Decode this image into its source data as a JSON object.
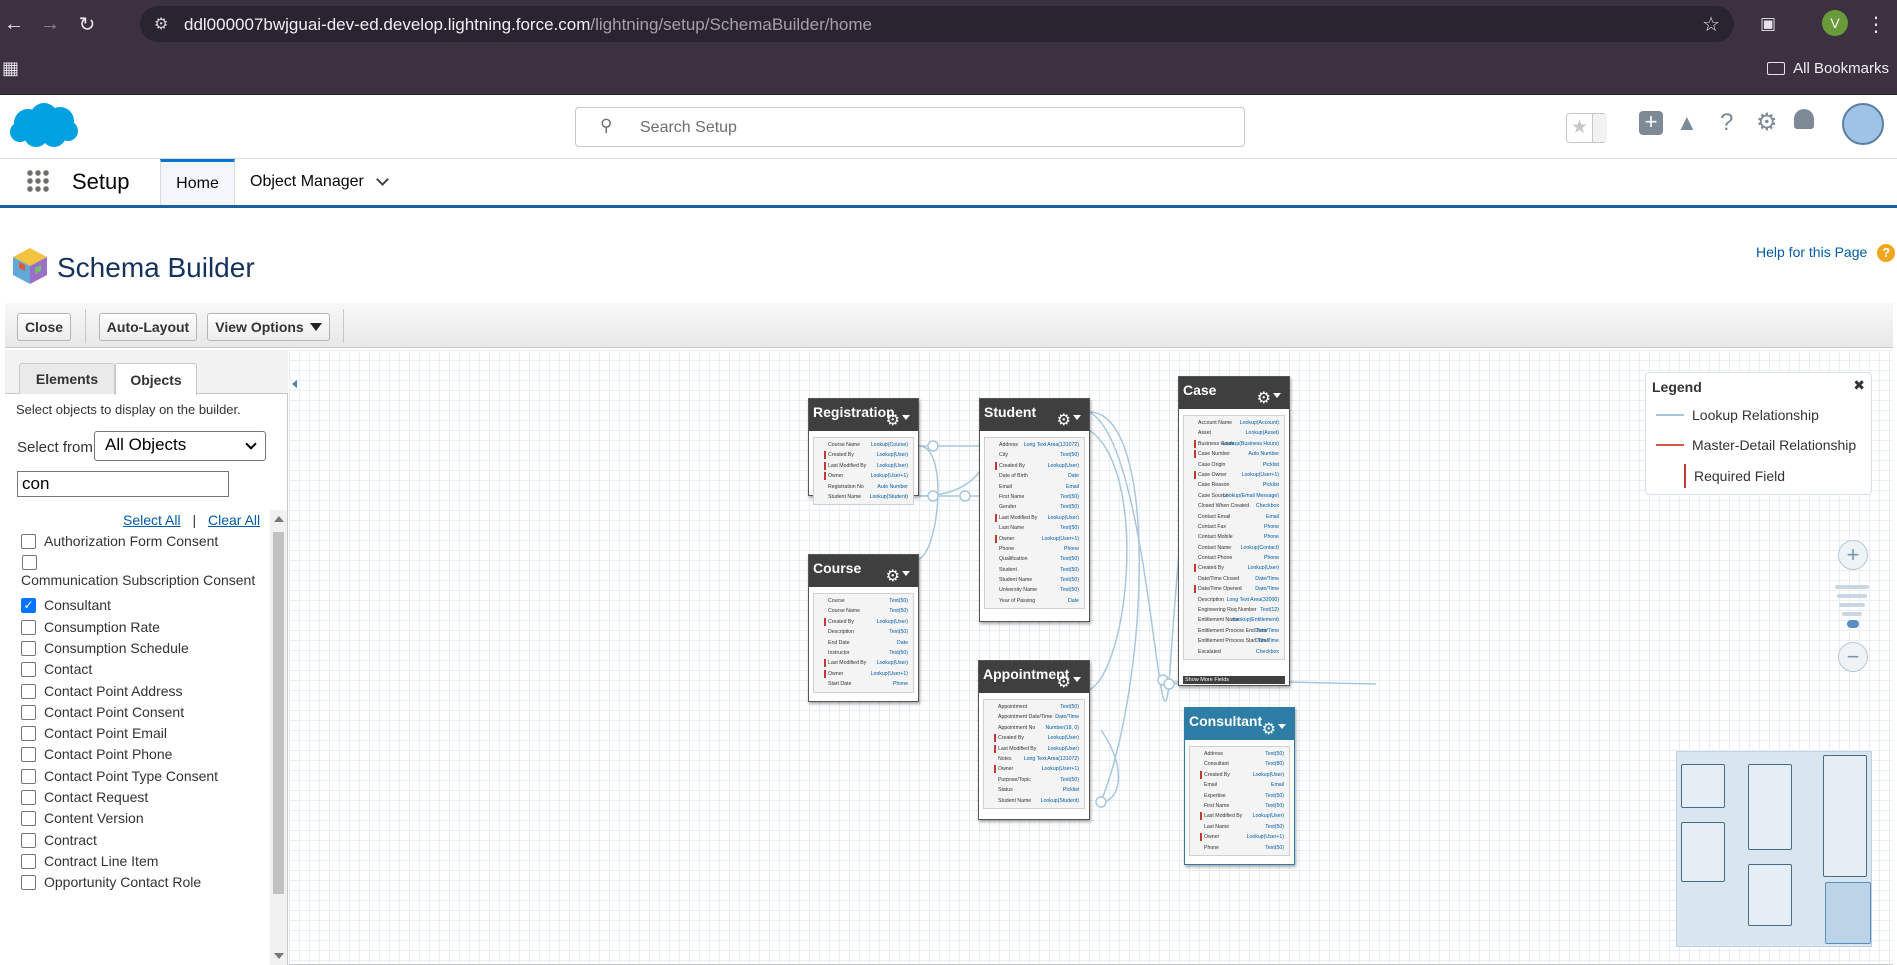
{
  "browser": {
    "url_host": "ddl000007bwjguai-dev-ed.develop.lightning.force.com",
    "url_path": "/lightning/setup/SchemaBuilder/home",
    "profile_initial": "V",
    "all_bookmarks": "All Bookmarks"
  },
  "header": {
    "search_placeholder": "Search Setup"
  },
  "nav": {
    "app_name": "Setup",
    "tabs": [
      "Home",
      "Object Manager"
    ]
  },
  "page": {
    "title": "Schema Builder",
    "help_link": "Help for this Page"
  },
  "toolbar": {
    "close": "Close",
    "auto_layout": "Auto-Layout",
    "view_options": "View Options"
  },
  "left_panel": {
    "tabs": [
      "Elements",
      "Objects"
    ],
    "description": "Select objects to display on the builder.",
    "select_from_label": "Select from",
    "select_from_value": "All Objects",
    "filter_value": "con",
    "select_all": "Select All",
    "clear_all": "Clear All",
    "objects": [
      {
        "label": "Authorization Form Consent",
        "checked": false
      },
      {
        "label": "Communication Subscription Consent",
        "checked": false
      },
      {
        "label": "Consultant",
        "checked": true
      },
      {
        "label": "Consumption Rate",
        "checked": false
      },
      {
        "label": "Consumption Schedule",
        "checked": false
      },
      {
        "label": "Contact",
        "checked": false
      },
      {
        "label": "Contact Point Address",
        "checked": false
      },
      {
        "label": "Contact Point Consent",
        "checked": false
      },
      {
        "label": "Contact Point Email",
        "checked": false
      },
      {
        "label": "Contact Point Phone",
        "checked": false
      },
      {
        "label": "Contact Point Type Consent",
        "checked": false
      },
      {
        "label": "Contact Request",
        "checked": false
      },
      {
        "label": "Content Version",
        "checked": false
      },
      {
        "label": "Contract",
        "checked": false
      },
      {
        "label": "Contract Line Item",
        "checked": false
      },
      {
        "label": "Opportunity Contact Role",
        "checked": false
      }
    ]
  },
  "schema_objects": {
    "registration": {
      "name": "Registration",
      "fields": [
        {
          "name": "Course Name",
          "type": "Lookup(Course)",
          "req": false
        },
        {
          "name": "Created By",
          "type": "Lookup(User)",
          "req": true
        },
        {
          "name": "Last Modified By",
          "type": "Lookup(User)",
          "req": true
        },
        {
          "name": "Owner",
          "type": "Lookup(User+1)",
          "req": true
        },
        {
          "name": "Registration No",
          "type": "Auto Number",
          "req": false
        },
        {
          "name": "Student Name",
          "type": "Lookup(Student)",
          "req": false
        }
      ]
    },
    "course": {
      "name": "Course",
      "fields": [
        {
          "name": "Course",
          "type": "Text(50)",
          "req": false
        },
        {
          "name": "Course Name",
          "type": "Text(50)",
          "req": false
        },
        {
          "name": "Created By",
          "type": "Lookup(User)",
          "req": true
        },
        {
          "name": "Description",
          "type": "Text(50)",
          "req": false
        },
        {
          "name": "End Date",
          "type": "Date",
          "req": false
        },
        {
          "name": "Instructor",
          "type": "Text(50)",
          "req": false
        },
        {
          "name": "Last Modified By",
          "type": "Lookup(User)",
          "req": true
        },
        {
          "name": "Owner",
          "type": "Lookup(User+1)",
          "req": true
        },
        {
          "name": "Start Date",
          "type": "Phone",
          "req": false
        }
      ]
    },
    "student": {
      "name": "Student",
      "fields": [
        {
          "name": "Address",
          "type": "Long Text Area(131072)",
          "req": false
        },
        {
          "name": "City",
          "type": "Text(50)",
          "req": false
        },
        {
          "name": "Created By",
          "type": "Lookup(User)",
          "req": true
        },
        {
          "name": "Date of Birth",
          "type": "Date",
          "req": false
        },
        {
          "name": "Email",
          "type": "Email",
          "req": false
        },
        {
          "name": "First Name",
          "type": "Text(50)",
          "req": false
        },
        {
          "name": "Gender",
          "type": "Text(50)",
          "req": false
        },
        {
          "name": "Last Modified By",
          "type": "Lookup(User)",
          "req": true
        },
        {
          "name": "Last Name",
          "type": "Text(50)",
          "req": false
        },
        {
          "name": "Owner",
          "type": "Lookup(User+1)",
          "req": true
        },
        {
          "name": "Phone",
          "type": "Phone",
          "req": false
        },
        {
          "name": "Qualification",
          "type": "Text(50)",
          "req": false
        },
        {
          "name": "Student",
          "type": "Text(50)",
          "req": false
        },
        {
          "name": "Student Name",
          "type": "Text(50)",
          "req": false
        },
        {
          "name": "University Name",
          "type": "Text(50)",
          "req": false
        },
        {
          "name": "Year of Passing",
          "type": "Date",
          "req": false
        }
      ]
    },
    "appointment": {
      "name": "Appointment",
      "fields": [
        {
          "name": "Appointment",
          "type": "Text(50)",
          "req": false
        },
        {
          "name": "Appointment Date/Time",
          "type": "Date/Time",
          "req": false
        },
        {
          "name": "Appointment No",
          "type": "Number(18, 0)",
          "req": false
        },
        {
          "name": "Created By",
          "type": "Lookup(User)",
          "req": true
        },
        {
          "name": "Last Modified By",
          "type": "Lookup(User)",
          "req": true
        },
        {
          "name": "Notes",
          "type": "Long Text Area(131072)",
          "req": false
        },
        {
          "name": "Owner",
          "type": "Lookup(User+1)",
          "req": true
        },
        {
          "name": "Purpose/Topic",
          "type": "Text(50)",
          "req": false
        },
        {
          "name": "Status",
          "type": "Picklist",
          "req": false
        },
        {
          "name": "Student Name",
          "type": "Lookup(Student)",
          "req": false
        }
      ]
    },
    "case": {
      "name": "Case",
      "show_more": "Show More Fields",
      "fields": [
        {
          "name": "Account Name",
          "type": "Lookup(Account)",
          "req": false
        },
        {
          "name": "Asset",
          "type": "Lookup(Asset)",
          "req": false
        },
        {
          "name": "Business Hours",
          "type": "Lookup(Business Hours)",
          "req": true
        },
        {
          "name": "Case Number",
          "type": "Auto Number",
          "req": true
        },
        {
          "name": "Case Origin",
          "type": "Picklist",
          "req": false
        },
        {
          "name": "Case Owner",
          "type": "Lookup(User+1)",
          "req": true
        },
        {
          "name": "Case Reason",
          "type": "Picklist",
          "req": false
        },
        {
          "name": "Case Source",
          "type": "Lookup(Email Message)",
          "req": false
        },
        {
          "name": "Closed When Created",
          "type": "Checkbox",
          "req": false
        },
        {
          "name": "Contact Email",
          "type": "Email",
          "req": false
        },
        {
          "name": "Contact Fax",
          "type": "Phone",
          "req": false
        },
        {
          "name": "Contact Mobile",
          "type": "Phone",
          "req": false
        },
        {
          "name": "Contact Name",
          "type": "Lookup(Contact)",
          "req": false
        },
        {
          "name": "Contact Phone",
          "type": "Phone",
          "req": false
        },
        {
          "name": "Created By",
          "type": "Lookup(User)",
          "req": true
        },
        {
          "name": "Date/Time Closed",
          "type": "Date/Time",
          "req": false
        },
        {
          "name": "Date/Time Opened",
          "type": "Date/Time",
          "req": true
        },
        {
          "name": "Description",
          "type": "Long Text Area(32000)",
          "req": false
        },
        {
          "name": "Engineering Req Number",
          "type": "Text(12)",
          "req": false
        },
        {
          "name": "Entitlement Name",
          "type": "Lookup(Entitlement)",
          "req": false
        },
        {
          "name": "Entitlement Process End Time",
          "type": "Date/Time",
          "req": false
        },
        {
          "name": "Entitlement Process Start Time",
          "type": "Date/Time",
          "req": false
        },
        {
          "name": "Escalated",
          "type": "Checkbox",
          "req": false
        }
      ]
    },
    "consultant": {
      "name": "Consultant",
      "fields": [
        {
          "name": "Address",
          "type": "Text(50)",
          "req": false
        },
        {
          "name": "Consultant",
          "type": "Text(80)",
          "req": false
        },
        {
          "name": "Created By",
          "type": "Lookup(User)",
          "req": true
        },
        {
          "name": "Email",
          "type": "Email",
          "req": false
        },
        {
          "name": "Expertise",
          "type": "Text(50)",
          "req": false
        },
        {
          "name": "First Name",
          "type": "Text(50)",
          "req": false
        },
        {
          "name": "Last Modified By",
          "type": "Lookup(User)",
          "req": true
        },
        {
          "name": "Last Name",
          "type": "Text(50)",
          "req": false
        },
        {
          "name": "Owner",
          "type": "Lookup(User+1)",
          "req": true
        },
        {
          "name": "Phone",
          "type": "Text(50)",
          "req": false
        }
      ]
    }
  },
  "legend": {
    "title": "Legend",
    "lookup": "Lookup Relationship",
    "master_detail": "Master-Detail Relationship",
    "required": "Required Field",
    "lookup_color": "#a9c7da",
    "master_detail_color": "#d9534f",
    "required_color": "#c23934"
  },
  "colors": {
    "browser_chrome": "#3c3140",
    "object_header": "#3f3f3f",
    "selected_object_header": "#2d7da6",
    "link": "#015ba7",
    "nav_accent": "#0176d3"
  }
}
